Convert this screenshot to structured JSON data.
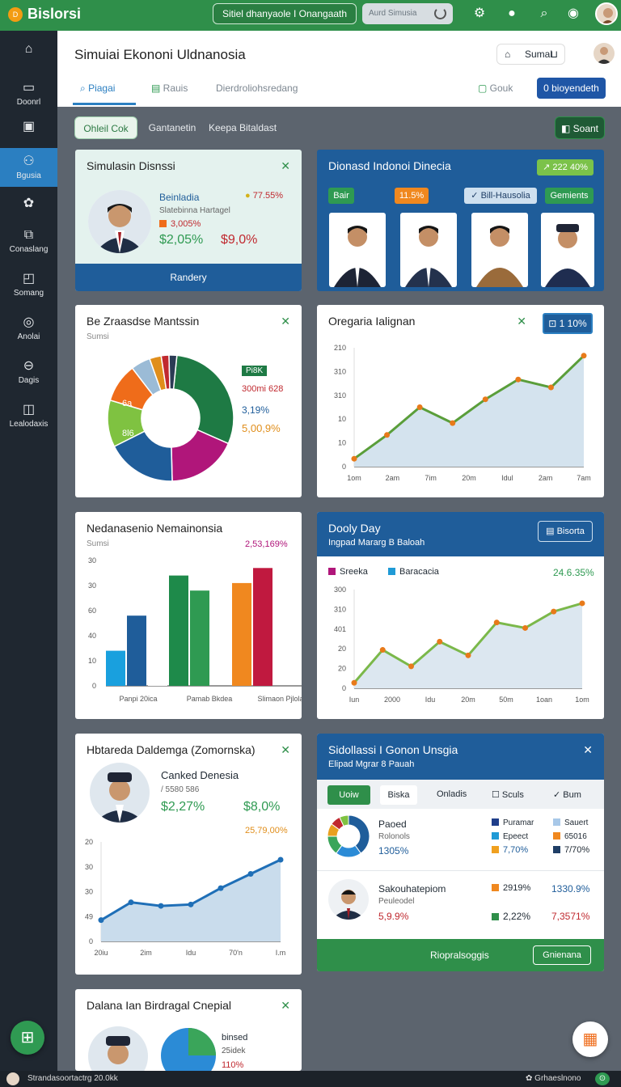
{
  "topbar": {
    "brand": "Bislorsi",
    "logo_glyph": "D",
    "search_text": "Sitiel dhanyaole I Onangaath",
    "grey_button": "Aurd Simusia"
  },
  "sidebar": {
    "items": [
      {
        "label": "",
        "icon": "home-icon"
      },
      {
        "label": "Doonrl",
        "icon": "window-icon"
      },
      {
        "label": "",
        "icon": "box-icon"
      },
      {
        "label": "Bgusia",
        "icon": "users-icon"
      },
      {
        "label": "",
        "icon": "flower-icon"
      },
      {
        "label": "Conaslang",
        "icon": "copy-icon"
      },
      {
        "label": "Somang",
        "icon": "square-icon"
      },
      {
        "label": "Anolai",
        "icon": "globe-icon"
      },
      {
        "label": "Dagis",
        "icon": "minus-circle-icon"
      },
      {
        "label": "Lealodaxis",
        "icon": "columns-icon"
      }
    ]
  },
  "header": {
    "title": "Simuiai Ekononi Uldnanosia",
    "btn_label": "Sumal",
    "tabs": [
      "Piagai",
      "Rauis",
      "Dierdroliohsredang"
    ],
    "tab_right": "Gouk",
    "primary": "0   bioyendeth"
  },
  "filters": {
    "chips": [
      "Ohleil Cok",
      "Gantanetin",
      "Keepa Bitaldast"
    ],
    "right_btn": "Soant"
  },
  "card1": {
    "title": "Simulasin Disnssi",
    "name": "Beinladia",
    "sub": "Slatebinna Hartagel",
    "pct": "3,005%",
    "val1": "$2,05%",
    "val2": "$9,0%",
    "badge": "77.55%",
    "footer": "Randery"
  },
  "card2": {
    "title": "Dionasd Indonoi Dinecia",
    "badge": "222 40%",
    "pills": [
      "Bair",
      "11.5%",
      "Bill-Hausolia",
      "Gemients"
    ]
  },
  "card3": {
    "title": "Be Zraasdse Mantssin",
    "sub": "Sumsi",
    "labels": [
      "Pi8K",
      "300mi 628",
      "3,19%",
      "5,00,9%",
      "6a",
      "8l6"
    ]
  },
  "card4": {
    "title": "Oregaria Ialignan",
    "badge": "1 10%",
    "yticks": [
      "210",
      "310",
      "310",
      "10",
      "10",
      "0"
    ],
    "xticks": [
      "1om",
      "2am",
      "7im",
      "20m",
      "Idul",
      "2am",
      "7am"
    ]
  },
  "card5": {
    "title": "Nedanasenio Nemainonsia",
    "sub": "Sumsi",
    "badge": "2,53,169%",
    "yticks": [
      "30",
      "30",
      "60",
      "40",
      "10",
      "0"
    ],
    "xlabels": [
      "Panpi  20ica",
      "Pamab Bkdea",
      "Slimaon Pjlola"
    ]
  },
  "card6": {
    "title": "Dooly Day",
    "sub": "Ingpad Mararg B Baloah",
    "btn": "Bisorta",
    "legend": [
      "Sreeka",
      "Baracacia"
    ],
    "badge": "24.6.35%",
    "yticks": [
      "300",
      "310",
      "401",
      "20",
      "20",
      "0"
    ],
    "xticks": [
      "Iun",
      "2000",
      "Idu",
      "20m",
      "50m",
      "1oan",
      "1om"
    ]
  },
  "card7": {
    "title": "Hbtareda Daldemga (Zomornska)",
    "name": "Canked Denesia",
    "sub": "/ 5580 586",
    "val1": "$2,27%",
    "val2": "$8,0%",
    "badge": "25,79,00%",
    "yticks": [
      "20",
      "30",
      "30",
      "49",
      "0"
    ],
    "xticks": [
      "20iu",
      "2im",
      "Idu",
      "70'n",
      "I.m"
    ]
  },
  "card8": {
    "title": "Sidollassi I Gonon Unsgia",
    "sub": "Elipad Mgrar 8 Pauah",
    "tabs": [
      "Uoiw",
      "Biska",
      "Onladis",
      "Sculs",
      "Bum"
    ],
    "row1": {
      "name": "Paoed",
      "sub": "Rolonols",
      "pct": "1305%",
      "l1": "Puramar",
      "l2": "Epeect",
      "l3": "7,70%",
      "r1": "Sauert",
      "r2": "65016",
      "r3": "7/70%"
    },
    "row2": {
      "name": "Sakouhatepiom",
      "sub": "Peuleodel",
      "pct": "5,9.9%",
      "m1": "2919%",
      "m2": "2,22%",
      "r1": "1330.9%",
      "r2": "7,3571%"
    },
    "footer": "Riopralsoggis",
    "footer_btn": "Gnienana"
  },
  "card9": {
    "title": "Dalana Ian Birdragal Cnepial",
    "name": "binsed",
    "sub": "25idek",
    "pct": "110%"
  },
  "bottombar": {
    "left": "Strandasoortactrg 20.0kk",
    "right": "Grhaeslnono"
  },
  "chart_data": [
    {
      "type": "pie",
      "title": "Be Zraasdse Mantssin",
      "values": [
        30,
        18,
        18,
        12,
        10,
        5,
        3,
        2,
        2
      ],
      "colors": [
        "#1e7a44",
        "#b0167a",
        "#1f5d9a",
        "#7fc241",
        "#ef6c1a",
        "#9bbbd6",
        "#e08e1b",
        "#c0292f",
        "#2b3b55"
      ]
    },
    {
      "type": "area",
      "title": "Oregaria Ialignan",
      "values": [
        10,
        40,
        75,
        55,
        85,
        110,
        100,
        140
      ],
      "ylim": [
        0,
        150
      ]
    },
    {
      "type": "bar",
      "title": "Nedanasenio Nemainonsia",
      "values": [
        14,
        28,
        12,
        44,
        38,
        0,
        41,
        47
      ],
      "colors": [
        "#19a0de",
        "#1f5d9a",
        "#ffffff",
        "#1e8a4a",
        "#2f9a52",
        "#ffffff",
        "#f0881f",
        "#c0193f"
      ],
      "ylim": [
        0,
        50
      ]
    },
    {
      "type": "area",
      "title": "Dooly Day",
      "series": [
        {
          "name": "Sreeka",
          "values": [
            10,
            70,
            40,
            85,
            60,
            120,
            110,
            140,
            155
          ]
        }
      ],
      "ylim": [
        0,
        180
      ]
    },
    {
      "type": "area",
      "title": "Hbtareda Daldemga (Zomornska)",
      "values": [
        30,
        55,
        50,
        52,
        75,
        95,
        115
      ],
      "ylim": [
        0,
        140
      ]
    }
  ]
}
